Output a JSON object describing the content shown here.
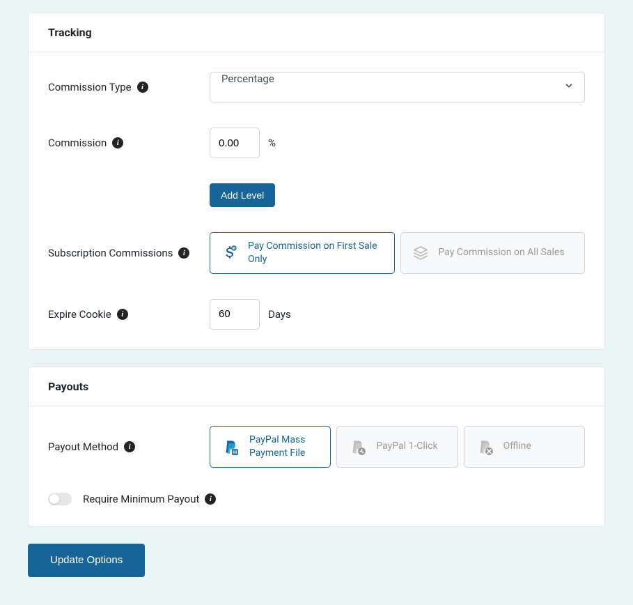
{
  "tracking": {
    "header": "Tracking",
    "commission_type": {
      "label": "Commission Type",
      "value": "Percentage"
    },
    "commission": {
      "label": "Commission",
      "value": "0.00",
      "suffix": "%"
    },
    "add_level_button": "Add Level",
    "subscription_commissions": {
      "label": "Subscription Commissions",
      "option_first_sale": "Pay Commission on First Sale Only",
      "option_all_sales": "Pay Commission on All Sales"
    },
    "expire_cookie": {
      "label": "Expire Cookie",
      "value": "60",
      "suffix": "Days"
    }
  },
  "payouts": {
    "header": "Payouts",
    "payout_method": {
      "label": "Payout Method",
      "option_paypal_file": "PayPal Mass Payment File",
      "option_paypal_1click": "PayPal 1-Click",
      "option_offline": "Offline"
    },
    "require_minimum": {
      "label": "Require Minimum Payout"
    }
  },
  "update_button": "Update Options"
}
